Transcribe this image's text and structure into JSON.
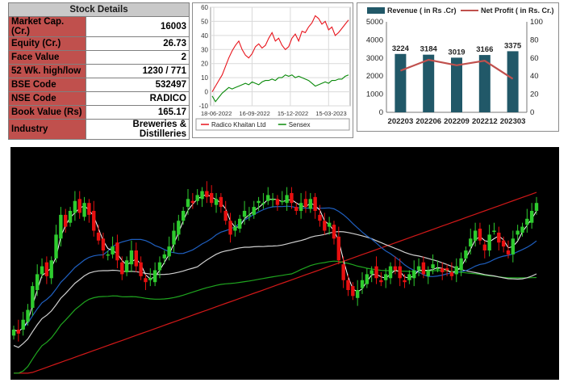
{
  "stock_details": {
    "title": "Stock Details",
    "rows": [
      {
        "label": "Market Cap. (Cr.)",
        "value": "16003"
      },
      {
        "label": "Equity (Cr.)",
        "value": "26.73"
      },
      {
        "label": "Face Value",
        "value": "2"
      },
      {
        "label": "52 Wk. high/low",
        "value": "1230 / 771"
      },
      {
        "label": "BSE Code",
        "value": "532497"
      },
      {
        "label": "NSE Code",
        "value": "RADICO"
      },
      {
        "label": "Book Value (Rs)",
        "value": "165.17"
      },
      {
        "label": "Industry",
        "value": "Breweries & Distilleries"
      }
    ]
  },
  "chart_data": [
    {
      "type": "line",
      "x_ticks": [
        "18-06-2022",
        "16-09-2022",
        "15-12-2022",
        "15-03-2023"
      ],
      "ylim": [
        -10,
        60
      ],
      "y_ticks": [
        -10,
        0,
        10,
        20,
        30,
        40,
        50,
        60
      ],
      "grid": true,
      "legend_position": "bottom",
      "series": [
        {
          "name": "Radico Khaitan Ltd",
          "color": "#e8141c",
          "values": [
            0,
            4,
            8,
            12,
            18,
            24,
            29,
            33,
            36,
            30,
            26,
            24,
            27,
            32,
            34,
            31,
            33,
            38,
            42,
            36,
            38,
            33,
            30,
            32,
            38,
            41,
            36,
            43,
            42,
            46,
            49,
            54,
            52,
            48,
            50,
            44,
            46,
            40,
            42,
            45,
            48,
            51
          ]
        },
        {
          "name": "Sensex",
          "color": "#0a8a0a",
          "values": [
            -3,
            -7,
            -4,
            -1,
            1,
            3,
            2,
            3,
            4,
            5,
            6,
            5,
            7,
            6,
            5,
            7,
            8,
            8,
            9,
            8,
            10,
            10,
            12,
            11,
            12,
            10,
            11,
            10,
            9,
            8,
            6,
            4,
            5,
            6,
            7,
            6,
            8,
            8,
            9,
            9,
            11,
            12
          ]
        }
      ]
    },
    {
      "type": "bar",
      "categories": [
        "202203",
        "202206",
        "202209",
        "202212",
        "202303"
      ],
      "series": [
        {
          "name": "Revenue ( in Rs .Cr)",
          "values": [
            3224,
            3184,
            3019,
            3166,
            3375
          ],
          "color": "#215868",
          "axis": "left"
        },
        {
          "name": "Net Profit ( in Rs. Cr.)",
          "values": [
            46,
            58,
            52,
            57,
            37
          ],
          "color": "#c0504d",
          "axis": "right",
          "type": "line"
        }
      ],
      "y_left_ticks": [
        0,
        1000,
        2000,
        3000,
        4000,
        5000
      ],
      "y_right_ticks": [
        0,
        20,
        40,
        60,
        80,
        100
      ],
      "data_labels": [
        "3224",
        "3184",
        "3019",
        "3166",
        "3375"
      ],
      "legend_position": "top"
    },
    {
      "type": "candlestick",
      "background": "#000000",
      "up_color": "#2ecc2e",
      "down_color": "#e81010",
      "moving_averages": [
        {
          "name": "ma-short",
          "color": "#ffffff"
        },
        {
          "name": "ma-blue",
          "color": "#1f5fbf"
        },
        {
          "name": "ma-grey",
          "color": "#cfcfcf"
        },
        {
          "name": "ma-green",
          "color": "#1fa51f"
        },
        {
          "name": "ma-red",
          "color": "#d01818"
        }
      ],
      "close": [
        20,
        18,
        25,
        30,
        42,
        48,
        52,
        47,
        55,
        68,
        78,
        72,
        80,
        85,
        79,
        84,
        78,
        70,
        65,
        60,
        58,
        62,
        55,
        48,
        55,
        60,
        52,
        47,
        44,
        46,
        50,
        54,
        58,
        62,
        70,
        75,
        80,
        86,
        84,
        88,
        90,
        87,
        84,
        86,
        82,
        75,
        68,
        72,
        76,
        80,
        78,
        82,
        85,
        84,
        88,
        86,
        83,
        85,
        88,
        84,
        80,
        84,
        82,
        86,
        80,
        75,
        70,
        74,
        66,
        55,
        45,
        40,
        37,
        40,
        45,
        48,
        50,
        46,
        44,
        48,
        52,
        50,
        46,
        44,
        48,
        50,
        52,
        48,
        50,
        53,
        51,
        49,
        50,
        47,
        52,
        56,
        60,
        66,
        70,
        65,
        60,
        68,
        70,
        64,
        62,
        58,
        66,
        70,
        72,
        76,
        80,
        84
      ]
    }
  ]
}
